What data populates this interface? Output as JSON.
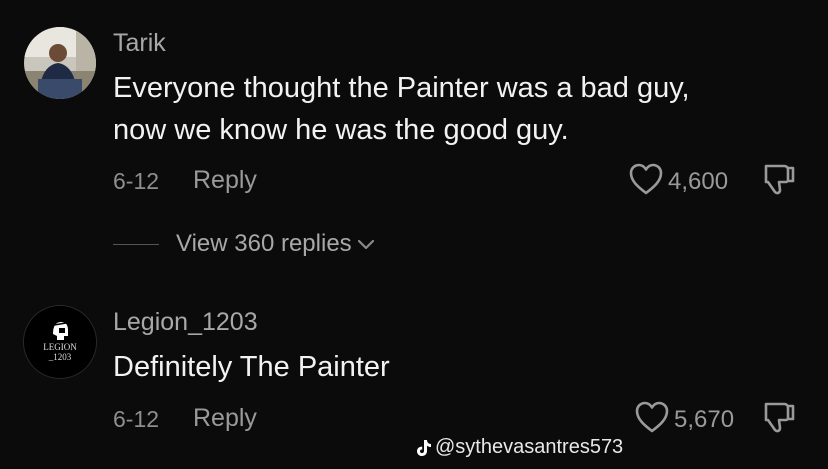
{
  "comments": [
    {
      "avatar": "user-photo-avatar",
      "username": "Tarik",
      "text_lines": [
        "Everyone thought the Painter was a bad guy,",
        "now we know he was the good guy."
      ],
      "date": "6-12",
      "reply_label": "Reply",
      "likes": "4,600",
      "view_replies": "View 360 replies"
    },
    {
      "avatar": "legion-logo-avatar",
      "avatar_text": [
        "LEGION",
        "_1203"
      ],
      "username": "Legion_1203",
      "text_lines": [
        "Definitely The Painter"
      ],
      "date": "6-12",
      "reply_label": "Reply",
      "likes": "5,670"
    }
  ],
  "watermark": {
    "icon": "tiktok-icon",
    "handle": "@sythevasantres573"
  },
  "colors": {
    "background": "#0b0b0b",
    "primary_text": "#f2f2f2",
    "secondary_text": "#9a9a9a"
  }
}
